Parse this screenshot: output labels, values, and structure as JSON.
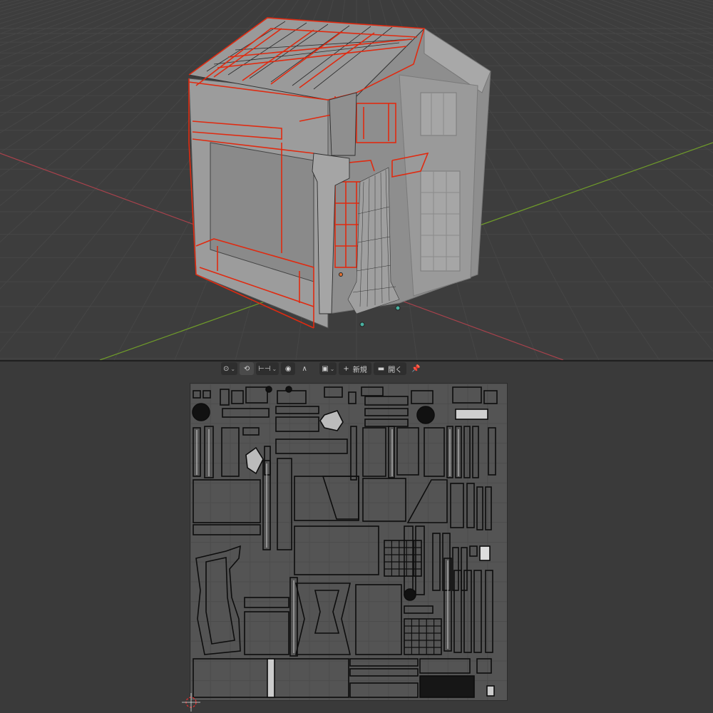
{
  "header": {
    "new_label": "新規",
    "open_label": "開く",
    "icons": [
      "pivot-icon",
      "sync-icon",
      "snap-icon",
      "proportional-edit-icon",
      "falloff-icon",
      "image-icon",
      "plus-icon",
      "folder-icon",
      "pin-icon"
    ]
  },
  "colors": {
    "viewport_bg": "#3d3d3d",
    "editor_bg": "#3a3a3a",
    "uv_grid_bg": "#545454",
    "selected_edge": "#e02a10",
    "x_axis": "#a8424c",
    "y_axis": "#6f9b2a",
    "mesh_light": "#bdbdbd"
  }
}
